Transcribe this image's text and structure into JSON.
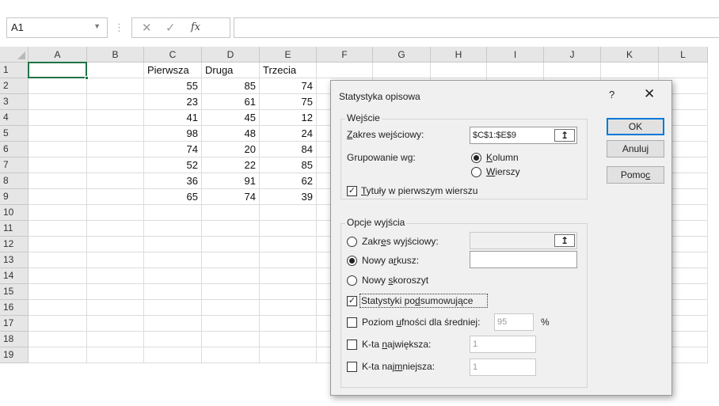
{
  "formula_bar": {
    "name_box": "A1",
    "name_box_dropdown": "▼",
    "separator": "⋮",
    "cancel_glyph": "✕",
    "enter_glyph": "✓",
    "fx_label": "fx",
    "formula": ""
  },
  "columns": [
    "A",
    "B",
    "C",
    "D",
    "E",
    "F",
    "G",
    "H",
    "I",
    "J",
    "K",
    "L"
  ],
  "rows": [
    "1",
    "2",
    "3",
    "4",
    "5",
    "6",
    "7",
    "8",
    "9",
    "10",
    "11",
    "12",
    "13",
    "14",
    "15",
    "16",
    "17",
    "18",
    "19"
  ],
  "sheet": {
    "headers": [
      "Pierwsza",
      "Druga",
      "Trzecia"
    ],
    "data": [
      [
        55,
        85,
        74
      ],
      [
        23,
        61,
        75
      ],
      [
        41,
        45,
        12
      ],
      [
        98,
        48,
        24
      ],
      [
        74,
        20,
        84
      ],
      [
        52,
        22,
        85
      ],
      [
        36,
        91,
        62
      ],
      [
        65,
        74,
        39
      ]
    ]
  },
  "dialog": {
    "title": "Statystyka opisowa",
    "help": "?",
    "close": "✕",
    "input_group": {
      "legend": "Wejście",
      "range_label_u": "Z",
      "range_label_rest": "akres wejściowy:",
      "range_value": "$C$1:$E$9",
      "grouping_label": "Grupowanie wg:",
      "by_columns_u": "K",
      "by_columns_rest": "olumn",
      "by_rows_u": "W",
      "by_rows_rest": "ierszy",
      "labels_u": "T",
      "labels_rest": "ytuły w pierwszym wierszu"
    },
    "output_group": {
      "legend": "Opcje wyjścia",
      "output_range_a": "Zakr",
      "output_range_u": "e",
      "output_range_b": "s wyjściowy:",
      "new_sheet_a": "Nowy a",
      "new_sheet_u": "r",
      "new_sheet_b": "kusz:",
      "new_workbook_a": "Nowy ",
      "new_workbook_u": "s",
      "new_workbook_b": "koroszyt",
      "summary_a": "Statystyki po",
      "summary_u": "d",
      "summary_b": "sumowujące",
      "confidence_a": "Poziom ",
      "confidence_u": "u",
      "confidence_b": "fności dla średniej:",
      "confidence_value": "95",
      "percent": "%",
      "kth_largest_a": "K-ta ",
      "kth_largest_u": "n",
      "kth_largest_b": "ajwiększa:",
      "kth_largest_value": "1",
      "kth_smallest_a": "K-ta naj",
      "kth_smallest_u": "m",
      "kth_smallest_b": "niejsza:",
      "kth_smallest_value": "1"
    },
    "buttons": {
      "ok": "OK",
      "cancel": "Anuluj",
      "help_a": "Pomo",
      "help_u": "c"
    },
    "ref_glyph": "↥"
  }
}
